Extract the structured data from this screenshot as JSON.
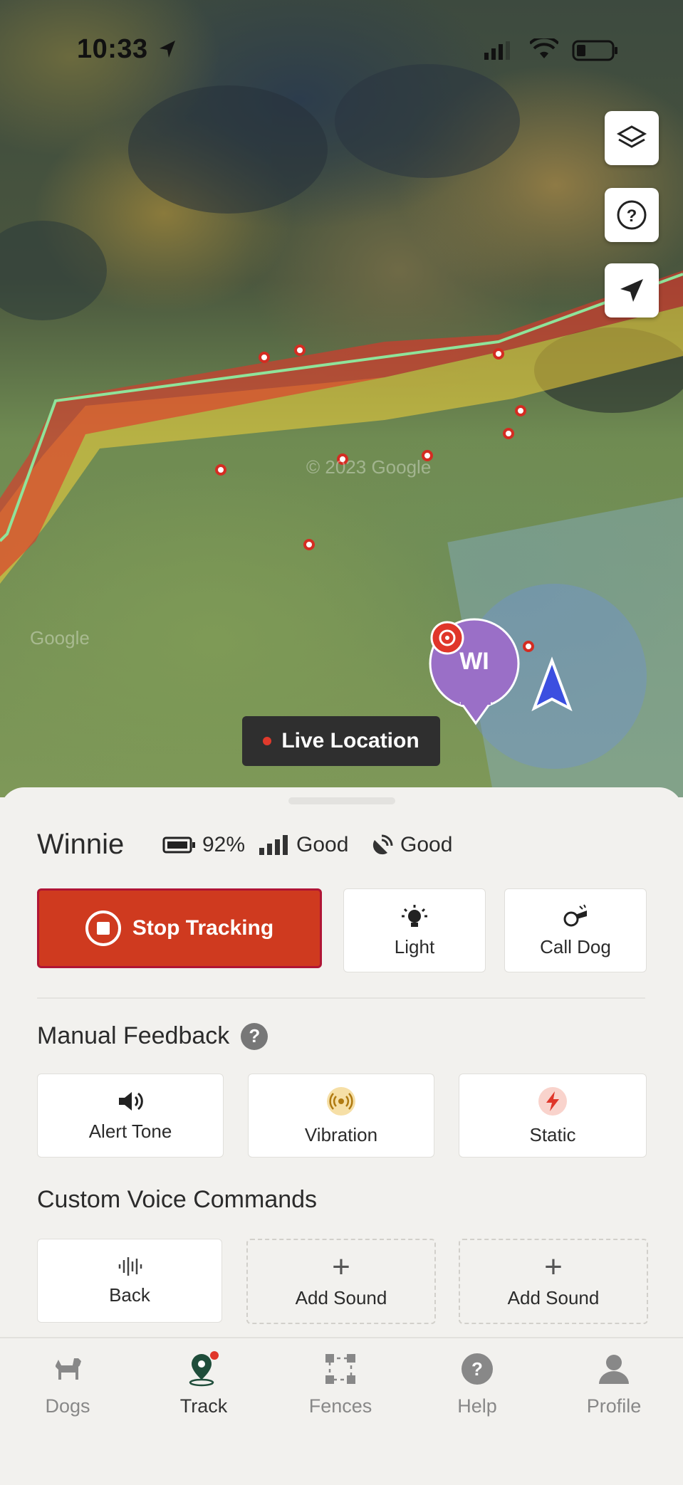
{
  "status_bar": {
    "time": "10:33"
  },
  "map": {
    "watermarks": [
      "© 2023 Google",
      "Google"
    ],
    "pin_label": "WI",
    "live_location_label": "Live Location",
    "buttons": [
      "layers-icon",
      "help-icon",
      "recenter-icon"
    ]
  },
  "dog": {
    "name": "Winnie",
    "battery": "92%",
    "signal": "Good",
    "gps": "Good"
  },
  "actions": {
    "stop_tracking": "Stop Tracking",
    "light": "Light",
    "call_dog": "Call Dog"
  },
  "manual_feedback": {
    "title": "Manual Feedback",
    "alert_tone": "Alert Tone",
    "vibration": "Vibration",
    "static": "Static"
  },
  "voice_commands": {
    "title": "Custom Voice Commands",
    "items": [
      "Back",
      "Add Sound",
      "Add Sound"
    ]
  },
  "tabs": [
    {
      "label": "Dogs",
      "icon": "dog-icon"
    },
    {
      "label": "Track",
      "icon": "track-icon",
      "active": true
    },
    {
      "label": "Fences",
      "icon": "fences-icon"
    },
    {
      "label": "Help",
      "icon": "help-icon"
    },
    {
      "label": "Profile",
      "icon": "profile-icon"
    }
  ],
  "colors": {
    "stop_tracking": "#cf3a1f",
    "fence_outer": "#8fe39a",
    "fence_red": "#e0362a",
    "fence_yellow": "#f2d23a",
    "zone_blue": "#8cb7e6",
    "pin": "#9a6fc7"
  }
}
